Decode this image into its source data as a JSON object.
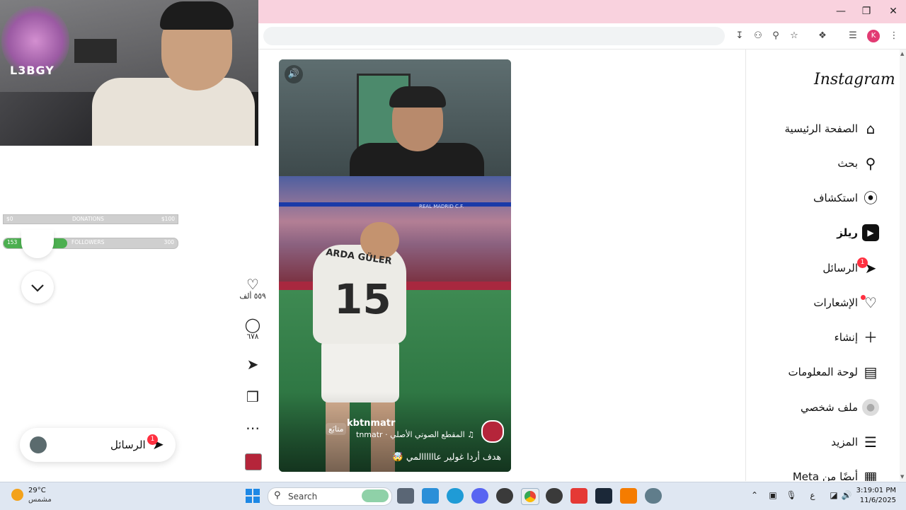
{
  "window": {
    "minimize_icon": "minimize-icon",
    "maximize_icon": "maximize-icon",
    "close_icon": "close-icon"
  },
  "toolbar": {
    "profile_initial": "K"
  },
  "stream": {
    "logo_text": "L3BGY",
    "donations": {
      "label": "DONATIONS",
      "left": "$0",
      "right": "$100"
    },
    "followers": {
      "label": "FOLLOWERS",
      "current": "153",
      "goal": "300",
      "progress_fraction": 0.51
    },
    "messages_float_label": "الرسائل",
    "messages_float_badge": "1"
  },
  "reel": {
    "author": "kbtnmatr",
    "follow_label": "متابَع",
    "audio_text": "tnmatr · المقطع الصوتي الأصلي",
    "caption": "هدف أردا غولير عاااااالمي 🤯",
    "jersey_name": "ARDA GÜLER",
    "jersey_number": "15",
    "banner": "REAL MADRID C.F."
  },
  "actions": {
    "likes": "٥٥٩ ألف",
    "comments": "٦٧٨"
  },
  "sidebar": {
    "logo": "Instagram",
    "items": [
      {
        "label": "الصفحة الرئيسية",
        "icon": "home-icon"
      },
      {
        "label": "بحث",
        "icon": "search-icon"
      },
      {
        "label": "استكشاف",
        "icon": "explore-icon"
      },
      {
        "label": "ريلز",
        "icon": "reels-icon"
      },
      {
        "label": "الرسائل",
        "icon": "messages-icon",
        "badge": "1"
      },
      {
        "label": "الإشعارات",
        "icon": "heart-icon"
      },
      {
        "label": "إنشاء",
        "icon": "plus-icon"
      },
      {
        "label": "لوحة المعلومات",
        "icon": "dashboard-icon"
      },
      {
        "label": "ملف شخصي",
        "icon": "profile-icon"
      },
      {
        "label": "المزيد",
        "icon": "menu-icon"
      },
      {
        "label": "أيضًا من Meta",
        "icon": "meta-icon"
      }
    ]
  },
  "taskbar": {
    "weather_temp": "29°C",
    "weather_condition": "مشمس",
    "search_placeholder": "Search",
    "ime": "ع",
    "time": "3:19:01 PM",
    "date": "11/6/2025"
  },
  "colors": {
    "titlebar": "#f9d2de",
    "badge": "#ff3040",
    "followers_fill": "#4caf50"
  }
}
